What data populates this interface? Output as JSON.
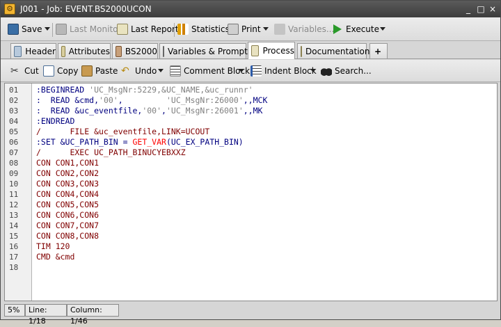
{
  "window": {
    "title": "J001 - Job: EVENT.BS2000UCON",
    "minimize": "_",
    "maximize": "□",
    "close": "×"
  },
  "toolbar": {
    "save": "Save",
    "last_monitor": "Last Monitor",
    "last_report": "Last Report",
    "statistics": "Statistics",
    "print": "Print",
    "variables": "Variables...",
    "execute": "Execute"
  },
  "tabs": [
    {
      "label": "Header"
    },
    {
      "label": "Attributes"
    },
    {
      "label": "BS2000"
    },
    {
      "label": "Variables & Prompts"
    },
    {
      "label": "Process"
    },
    {
      "label": "Documentation"
    },
    {
      "label": "+"
    }
  ],
  "edit_toolbar": {
    "cut": "Cut",
    "copy": "Copy",
    "paste": "Paste",
    "undo": "Undo",
    "comment_block": "Comment Block",
    "indent_block": "Indent Block",
    "search": "Search..."
  },
  "colors": {
    "keyword": "#000080",
    "string": "#808080",
    "plain": "#000080",
    "bs2000": "#800000",
    "func": "#ff0000",
    "comment": "#800000"
  },
  "lines": [
    {
      "no": "01",
      "segs": [
        {
          "t": ":BEGINREAD ",
          "c": "keyword"
        },
        {
          "t": "'UC_MsgNr:5229,&UC_NAME,&uc_runnr'",
          "c": "string"
        }
      ]
    },
    {
      "no": "02",
      "segs": [
        {
          "t": ":  READ &cmd,",
          "c": "keyword"
        },
        {
          "t": "'00'",
          "c": "string"
        },
        {
          "t": ",         ",
          "c": "keyword"
        },
        {
          "t": "'UC_MsgNr:26000'",
          "c": "string"
        },
        {
          "t": ",,MCK",
          "c": "keyword"
        }
      ]
    },
    {
      "no": "03",
      "segs": [
        {
          "t": ":  READ &uc_eventfile,",
          "c": "keyword"
        },
        {
          "t": "'00'",
          "c": "string"
        },
        {
          "t": ",",
          "c": "keyword"
        },
        {
          "t": "'UC_MsgNr:26001'",
          "c": "string"
        },
        {
          "t": ",,MK",
          "c": "keyword"
        }
      ]
    },
    {
      "no": "04",
      "segs": [
        {
          "t": ":ENDREAD",
          "c": "keyword"
        }
      ]
    },
    {
      "no": "05",
      "segs": [
        {
          "t": "/      FILE &uc_eventfile,LINK=UCOUT",
          "c": "bs2000"
        }
      ]
    },
    {
      "no": "06",
      "segs": [
        {
          "t": ":SET &UC_PATH_BIN = ",
          "c": "keyword"
        },
        {
          "t": "GET_VAR",
          "c": "func"
        },
        {
          "t": "(UC_EX_PATH_BIN)",
          "c": "keyword"
        }
      ]
    },
    {
      "no": "07",
      "segs": [
        {
          "t": "/      EXEC UC_PATH_BINUCYEBXXZ",
          "c": "bs2000"
        }
      ]
    },
    {
      "no": "08",
      "segs": [
        {
          "t": "CON CON1,CON1",
          "c": "bs2000"
        }
      ]
    },
    {
      "no": "09",
      "segs": [
        {
          "t": "CON CON2,CON2",
          "c": "bs2000"
        }
      ]
    },
    {
      "no": "10",
      "segs": [
        {
          "t": "CON CON3,CON3",
          "c": "bs2000"
        }
      ]
    },
    {
      "no": "11",
      "segs": [
        {
          "t": "CON CON4,CON4",
          "c": "bs2000"
        }
      ]
    },
    {
      "no": "12",
      "segs": [
        {
          "t": "CON CON5,CON5",
          "c": "bs2000"
        }
      ]
    },
    {
      "no": "13",
      "segs": [
        {
          "t": "CON CON6,CON6",
          "c": "bs2000"
        }
      ]
    },
    {
      "no": "14",
      "segs": [
        {
          "t": "CON CON7,CON7",
          "c": "bs2000"
        }
      ]
    },
    {
      "no": "15",
      "segs": [
        {
          "t": "CON CON8,CON8",
          "c": "bs2000"
        }
      ]
    },
    {
      "no": "16",
      "segs": [
        {
          "t": "TIM 120",
          "c": "bs2000"
        }
      ]
    },
    {
      "no": "17",
      "segs": [
        {
          "t": "CMD &cmd",
          "c": "bs2000"
        }
      ]
    },
    {
      "no": "18",
      "segs": []
    }
  ],
  "status": {
    "zoom": "5%",
    "line": "Line: 1/18",
    "column": "Column: 1/46"
  }
}
